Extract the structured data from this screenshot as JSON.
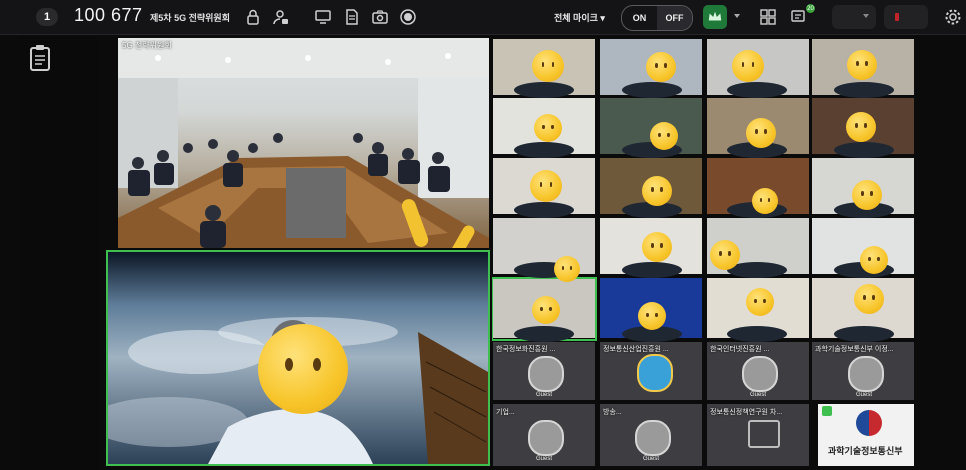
{
  "topbar": {
    "page_number": "1",
    "meeting_id": "100 677",
    "meeting_title": "제5차 5G 전략위원회",
    "mic_select": "전체 마이크 ▾",
    "toggle_on": "ON",
    "toggle_off": "OFF",
    "chat_badge": "20"
  },
  "main_room": {
    "label": "5G 전략위원회"
  },
  "grid": {
    "row6_labels": [
      "한국정보화진흥원 ...",
      "정보통신산업진흥원 ...",
      "한국인터넷진흥원 ...",
      "과학기술정보통신부 이정..."
    ],
    "row7_labels": [
      "기업...",
      "방송...",
      "정보통신정책연구원 차...",
      ""
    ],
    "guest_label": "Guest",
    "ministry_name": "과학기술정보통신부"
  },
  "colors": {
    "accent_green": "#3fbf4f",
    "crown_green": "#1f7a3a",
    "topbar_bg": "#141416"
  }
}
